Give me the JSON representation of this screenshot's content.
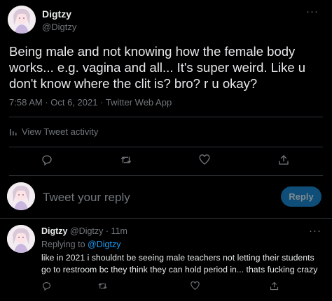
{
  "tweet": {
    "author_name": "Digtzy",
    "author_handle": "@Digtzy",
    "text": "Being male and not knowing how the female body works... e.g. vagina and all... It's super weird. Like u don't know where the clit is? bro? r u okay?",
    "meta": "7:58 AM · Oct 6, 2021 · Twitter Web App",
    "activity_label": "View Tweet activity",
    "more_icon": "ellipsis-icon"
  },
  "actions": {
    "icons": [
      "reply-icon",
      "retweet-icon",
      "like-icon",
      "share-icon"
    ]
  },
  "composer": {
    "placeholder": "Tweet your reply",
    "button_label": "Reply",
    "button_color": "#0f4e78"
  },
  "reply": {
    "author_name": "Digtzy",
    "author_handle": "@Digtzy",
    "separator": "·",
    "time": "11m",
    "replying_to_label": "Replying to",
    "replying_to_handle": "@Digtzy",
    "text": "like in 2021 i shouldnt be seeing male teachers not letting their students go to restroom bc they think they can hold period in... thats fucking crazy"
  },
  "colors": {
    "background": "#000000",
    "text": "#e7e9ea",
    "secondary": "#71767b",
    "accent": "#1d9bf0",
    "divider": "#2f3336"
  }
}
